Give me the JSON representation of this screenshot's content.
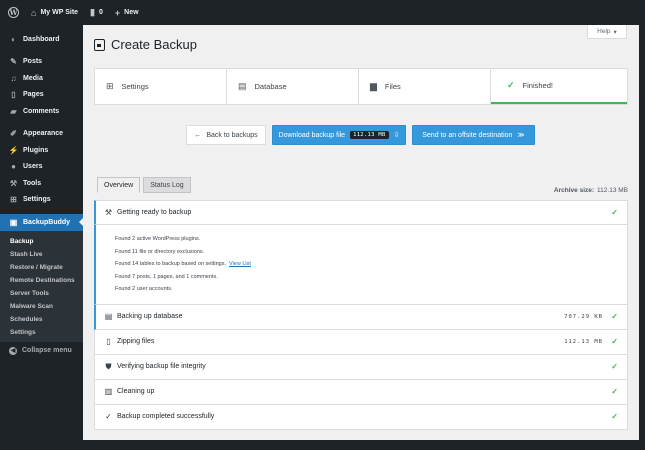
{
  "adminbar": {
    "site_name": "My WP Site",
    "comments_count": "0",
    "new_label": "New"
  },
  "sidebar": {
    "items": [
      {
        "label": "Dashboard",
        "icon": "dashboard-icon"
      },
      {
        "label": "Posts",
        "icon": "pin-icon"
      },
      {
        "label": "Media",
        "icon": "media-icon"
      },
      {
        "label": "Pages",
        "icon": "pages-icon"
      },
      {
        "label": "Comments",
        "icon": "comment-icon"
      },
      {
        "label": "Appearance",
        "icon": "brush-icon"
      },
      {
        "label": "Plugins",
        "icon": "plug-icon"
      },
      {
        "label": "Users",
        "icon": "user-icon"
      },
      {
        "label": "Tools",
        "icon": "wrench-icon"
      },
      {
        "label": "Settings",
        "icon": "settings-icon"
      },
      {
        "label": "BackupBuddy",
        "icon": "backupbuddy-icon"
      }
    ],
    "submenu": [
      "Backup",
      "Stash Live",
      "Restore / Migrate",
      "Remote Destinations",
      "Server Tools",
      "Malware Scan",
      "Schedules",
      "Settings"
    ],
    "collapse_label": "Collapse menu"
  },
  "main": {
    "help_label": "Help",
    "title": "Create Backup",
    "steps": [
      "Settings",
      "Database",
      "Files",
      "Finished!"
    ],
    "buttons": {
      "back": "Back to backups",
      "download": "Download backup file",
      "download_size": "112.13 MB",
      "offsite": "Send to an offsite destination"
    },
    "tabs": [
      "Overview",
      "Status Log"
    ],
    "archive_size_label": "Archive size:",
    "archive_size_value": "112.13 MB",
    "status": {
      "getting_ready": "Getting ready to backup",
      "details": [
        "Found 2 active WordPress plugins.",
        "Found 11 file or directory exclusions.",
        "Found 14 tables to backup based on settings.",
        "Found 7 posts, 1 pages, and 1 comments.",
        "Found 2 user accounts."
      ],
      "view_list": "View List",
      "backing_db": "Backing up database",
      "backing_db_size": "707.29 KB",
      "zipping": "Zipping files",
      "zipping_size": "112.13 MB",
      "verifying": "Verifying backup file integrity",
      "cleaning": "Cleaning up",
      "completed": "Backup completed successfully"
    },
    "colors": {
      "accent_blue": "#3498db",
      "success_green": "#46b450",
      "menu_current": "#2271b1"
    }
  }
}
